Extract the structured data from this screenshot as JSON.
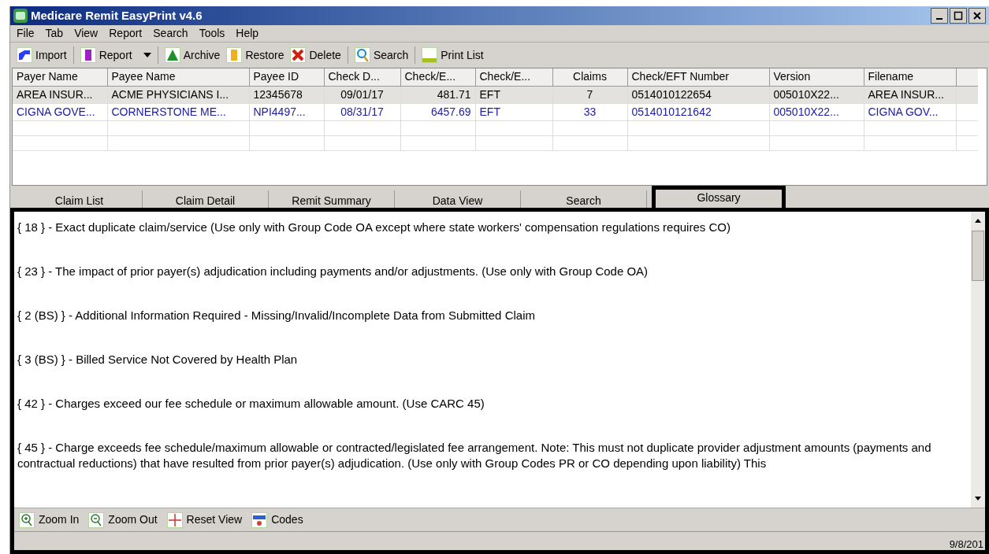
{
  "window": {
    "title": "Medicare Remit EasyPrint v4.6"
  },
  "menu": [
    "File",
    "Tab",
    "View",
    "Report",
    "Search",
    "Tools",
    "Help"
  ],
  "toolbar": [
    {
      "kind": "import",
      "label": "Import"
    },
    {
      "kind": "report",
      "label": "Report",
      "dropdown": true
    },
    {
      "kind": "archive",
      "label": "Archive"
    },
    {
      "kind": "restore",
      "label": "Restore"
    },
    {
      "kind": "delete",
      "label": "Delete"
    },
    {
      "kind": "search",
      "label": "Search"
    },
    {
      "kind": "print",
      "label": "Print List"
    }
  ],
  "table": {
    "columns": [
      "Payer Name",
      "Payee Name",
      "Payee ID",
      "Check D...",
      "Check/E...",
      "Check/E...",
      "Claims",
      "Check/EFT Number",
      "Version",
      "Filename"
    ],
    "rows": [
      {
        "selected": true,
        "color": "#000000",
        "cells": [
          "AREA INSUR...",
          "ACME PHYSICIANS I...",
          "12345678",
          "09/01/17",
          "481.71",
          "EFT",
          "7",
          "0514010122654",
          "005010X22...",
          "AREA INSUR..."
        ]
      },
      {
        "selected": false,
        "color": "#1a1aa6",
        "cells": [
          "CIGNA GOVE...",
          "CORNERSTONE ME...",
          "NPI4497...",
          "08/31/17",
          "6457.69",
          "EFT",
          "33",
          "0514010121642",
          "005010X22...",
          "CIGNA GOV..."
        ]
      }
    ]
  },
  "tabs": [
    {
      "label": "Claim List",
      "selected": false
    },
    {
      "label": "Claim Detail",
      "selected": false
    },
    {
      "label": "Remit Summary",
      "selected": false
    },
    {
      "label": "Data View",
      "selected": false
    },
    {
      "label": "Search",
      "selected": false
    },
    {
      "label": "Glossary",
      "selected": true
    }
  ],
  "glossary": [
    "{ 18 } - Exact duplicate claim/service (Use only with Group Code OA except where state workers' compensation regulations requires CO)",
    "{ 23 } - The impact of prior payer(s) adjudication including payments and/or adjustments. (Use only with Group Code OA)",
    "{ 2 (BS) } - Additional Information Required - Missing/Invalid/Incomplete Data from Submitted Claim",
    "{ 3 (BS) } - Billed Service Not Covered by Health Plan",
    "{ 42 } - Charges exceed our fee schedule or maximum allowable amount. (Use CARC 45)",
    "{ 45 } - Charge exceeds fee schedule/maximum allowable or contracted/legislated fee arrangement. Note: This must not duplicate provider adjustment amounts (payments and contractual reductions) that have resulted from prior payer(s) adjudication. (Use only with Group Codes PR or CO depending upon liability) This"
  ],
  "bottom_toolbar": [
    {
      "kind": "zoom-in",
      "label": "Zoom In"
    },
    {
      "kind": "zoom-out",
      "label": "Zoom Out"
    },
    {
      "kind": "reset",
      "label": "Reset View"
    },
    {
      "kind": "codes",
      "label": "Codes"
    }
  ],
  "status_bar": {
    "date": "9/8/201"
  }
}
